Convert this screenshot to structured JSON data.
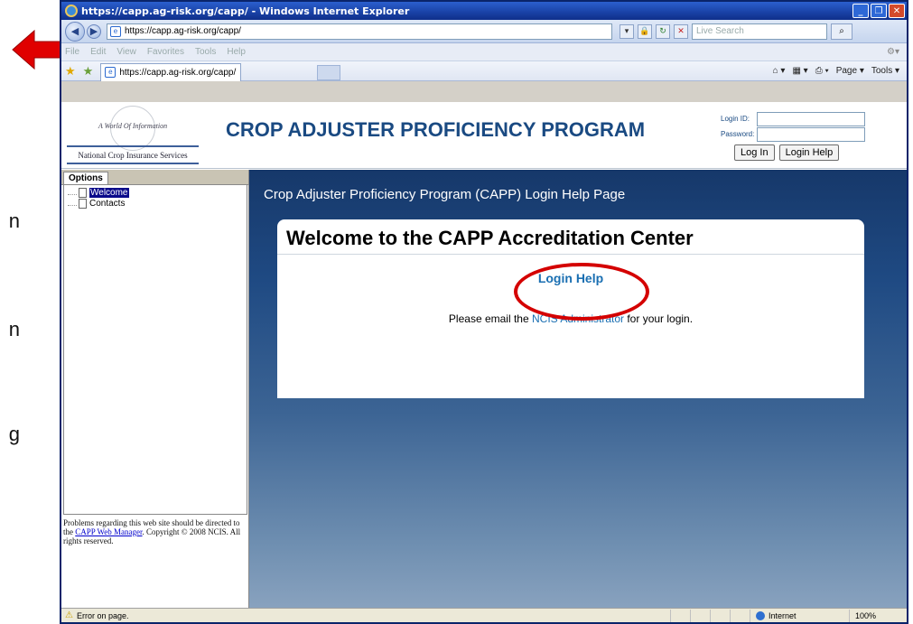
{
  "slide": {
    "fragments": [
      "n",
      "n",
      "g"
    ]
  },
  "browser": {
    "title": "https://capp.ag-risk.org/capp/ - Windows Internet Explorer",
    "address": "https://capp.ag-risk.org/capp/",
    "search_placeholder": "Live Search",
    "menu": [
      "File",
      "Edit",
      "View",
      "Favorites",
      "Tools",
      "Help"
    ],
    "tab_title": "https://capp.ag-risk.org/capp/",
    "commands": [
      "Page ▾",
      "Tools ▾"
    ]
  },
  "header": {
    "logo_tagline": "A World Of Information",
    "logo_name": "National Crop Insurance Services",
    "program_title": "CROP ADJUSTER PROFICIENCY PROGRAM",
    "login_id_label": "Login ID:",
    "password_label": "Password:",
    "login_button": "Log In",
    "login_help_button": "Login Help"
  },
  "sidebar": {
    "tab": "Options",
    "items": [
      {
        "label": "Welcome",
        "selected": true
      },
      {
        "label": "Contacts",
        "selected": false
      }
    ],
    "footer_text1": "Problems regarding this web site should be directed to the ",
    "footer_link": "CAPP Web Manager",
    "footer_text2": ". Copyright © 2008 NCIS. All rights reserved."
  },
  "content": {
    "page_heading": "Crop Adjuster Proficiency Program (CAPP) Login Help Page",
    "panel_title": "Welcome to the CAPP Accreditation Center",
    "section_title": "Login Help",
    "message_before": "Please email the ",
    "message_link": "NCIS Administrator",
    "message_after": " for your login."
  },
  "status": {
    "message": "Error on page.",
    "zone": "Internet",
    "zoom": "100%"
  },
  "colors": {
    "annotation": "#d40000",
    "title_blue": "#1a4a82",
    "link_blue": "#1a6fb2"
  }
}
